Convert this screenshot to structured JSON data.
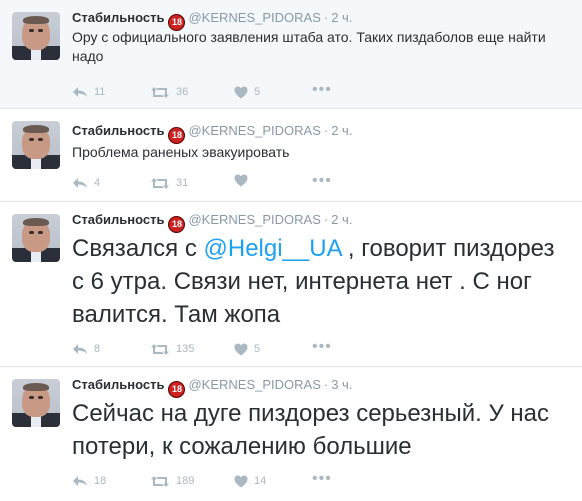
{
  "tweets": [
    {
      "name": "Стабильность",
      "badge": "18",
      "handle": "@KERNES_PIDORAS",
      "separator": "·",
      "time": "2 ч.",
      "text": "Ору с официального заявления штаба ато. Таких пиздаболов еще найти надо",
      "replies": "11",
      "retweets": "36",
      "likes": "5",
      "more": "•••"
    },
    {
      "name": "Стабильность",
      "badge": "18",
      "handle": "@KERNES_PIDORAS",
      "separator": "·",
      "time": "2 ч.",
      "text": "Проблема раненых эвакуировать",
      "replies": "4",
      "retweets": "31",
      "likes": "",
      "more": "•••"
    },
    {
      "name": "Стабильность",
      "badge": "18",
      "handle": "@KERNES_PIDORAS",
      "separator": "·",
      "time": "2 ч.",
      "text_before": "Связался с ",
      "mention": "@Helgi__UA",
      "text_after": " , говорит пиздорез с 6 утра. Связи нет, интернета нет . С ног валится. Там жопа",
      "replies": "8",
      "retweets": "135",
      "likes": "5",
      "more": "•••"
    },
    {
      "name": "Стабильность",
      "badge": "18",
      "handle": "@KERNES_PIDORAS",
      "separator": "·",
      "time": "3 ч.",
      "text": "Сейчас на дуге пиздорез серьезный. У нас потери, к сожалению большие",
      "replies": "18",
      "retweets": "189",
      "likes": "14",
      "more": "•••"
    }
  ],
  "icons": {
    "reply": "reply-icon",
    "retweet": "retweet-icon",
    "like": "heart-icon",
    "more": "more-icon"
  },
  "colors": {
    "mention": "#1da1f2",
    "muted": "#8899a6",
    "action": "#aab8c2",
    "highlight_bg": "#f5f8fa"
  }
}
